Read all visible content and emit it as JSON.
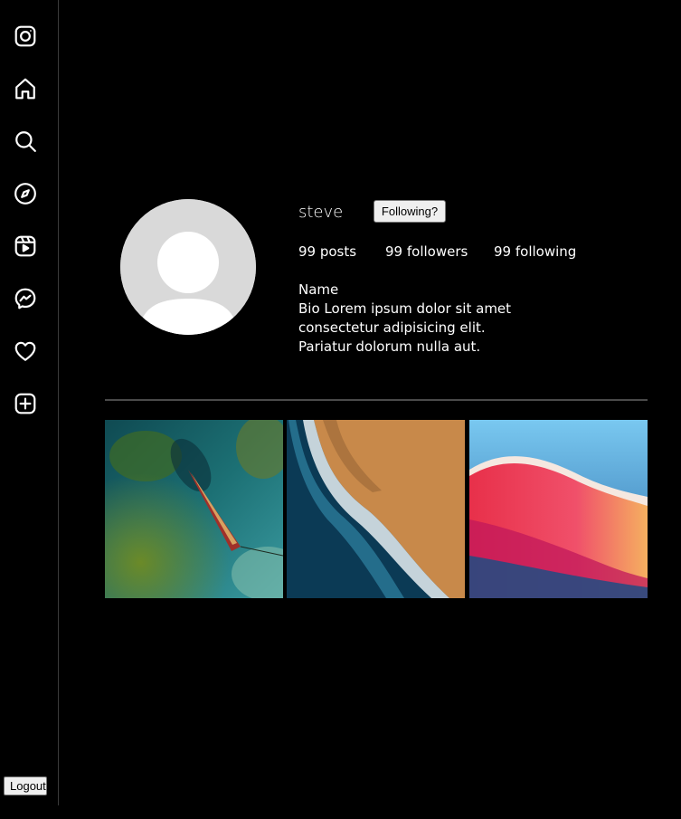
{
  "sidebar": {
    "icons": [
      "instagram-logo-icon",
      "home-icon",
      "search-icon",
      "explore-compass-icon",
      "reels-icon",
      "messenger-icon",
      "heart-icon",
      "create-plus-icon"
    ],
    "logout_label": "Logout"
  },
  "profile": {
    "username": "steve",
    "follow_button_label": "Following?",
    "stats": {
      "posts": "99 posts",
      "followers": "99 followers",
      "following": "99 following"
    },
    "name": "Name",
    "bio_lines": [
      "Bio Lorem ipsum dolor sit amet",
      "consectetur adipisicing elit.",
      "Pariatur dolorum nulla aut."
    ]
  },
  "posts": [
    {
      "image": "boat-in-water-photo"
    },
    {
      "image": "waves-on-beach-photo"
    },
    {
      "image": "colorful-abstract-wallpaper"
    }
  ],
  "colors": {
    "background": "#000000",
    "text": "#ffffff",
    "avatar": "#d9d9d9",
    "divider": "#4a4a4a"
  }
}
